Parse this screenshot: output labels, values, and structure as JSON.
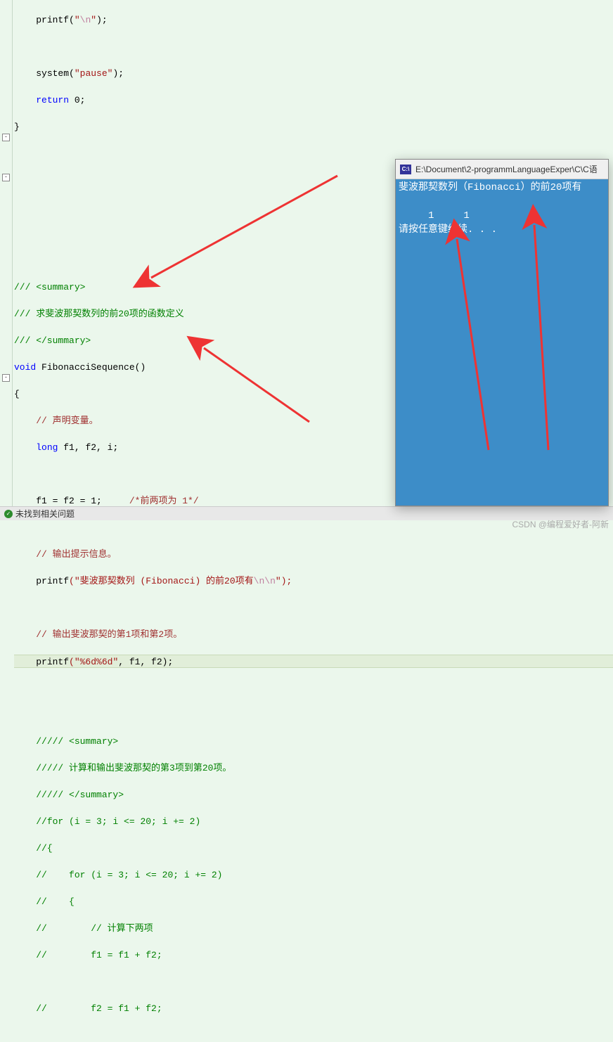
{
  "code": {
    "l1_printf": "printf",
    "l1_paren_open": "(",
    "l1_string_open": "\"",
    "l1_escape": "\\n",
    "l1_string_close": "\"",
    "l1_end": ");",
    "l3_system": "system",
    "l3_string": "\"pause\"",
    "l4_return": "return",
    "l4_zero": " 0",
    "l4_semi": ";",
    "l5_brace": "}",
    "c1": "/// <summary>",
    "c2": "/// 求斐波那契数列的前20项的函数定义",
    "c3": "/// </summary>",
    "func_kw": "void",
    "func_name": " FibonacciSequence()",
    "open_brace": "{",
    "c_var": "// 声明变量。",
    "long_kw": "long",
    "long_rest": " f1, f2, i;",
    "assign": "f1 = f2 = 1;",
    "assign_comment": "     /*前两项为 1*/",
    "c_hint": "// 输出提示信息。",
    "p1_printf": "printf",
    "p1_str_open": "(\"",
    "p1_str_body": "斐波那契数列 (Fibonacci) 的前20项有",
    "p1_escape": "\\n\\n",
    "p1_end": "\");",
    "c_out12": "// 输出斐波那契的第1项和第2项。",
    "p2_printf": "printf",
    "p2_str": "(\"%6d%6d\"",
    "p2_args": ", f1, f2);",
    "cc1": "///// <summary>",
    "cc2": "///// 计算和输出斐波那契的第3项到第20项。",
    "cc3": "///// </summary>",
    "cc4": "//for (i = 3; i <= 20; i += 2)",
    "cc5": "//{",
    "cc6": "//    for (i = 3; i <= 20; i += 2)",
    "cc7": "//    {",
    "cc8": "//        // 计算下两项",
    "cc9": "//        f1 = f1 + f2;",
    "cc10": "",
    "cc11": "//        f2 = f1 + f2;"
  },
  "console": {
    "titlebar_path": "E:\\Document\\2-programmLanguageExper\\C\\C语",
    "icon_text": "C:\\",
    "line1": "斐波那契数列（Fibonacci）的前20项有",
    "line2": "     1     1",
    "line3": "请按任意键继续. . ."
  },
  "statusbar": {
    "message": "未找到相关问题"
  },
  "watermark": "CSDN @编程爱好者-阿新"
}
